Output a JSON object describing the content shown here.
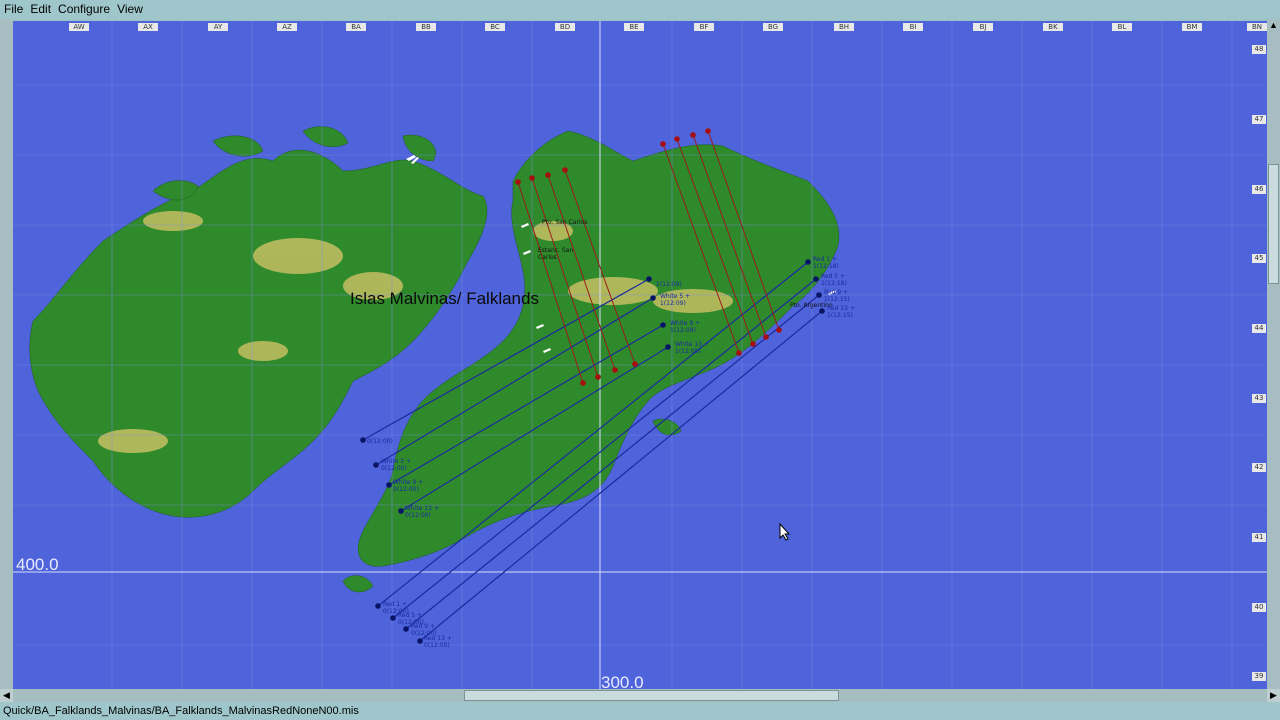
{
  "menu": {
    "file": "File",
    "edit": "Edit",
    "configure": "Configure",
    "view": "View"
  },
  "map": {
    "island_label": "Islas Malvinas/ Falklands",
    "scale_left": "400.0",
    "scale_bottom": "300.0",
    "columns": [
      "AW",
      "AX",
      "AY",
      "AZ",
      "BA",
      "BB",
      "BC",
      "BD",
      "BE",
      "BF",
      "BG",
      "BH",
      "BI",
      "BJ",
      "BK",
      "BL",
      "BM",
      "BN"
    ],
    "rows": [
      "48",
      "47",
      "46",
      "45",
      "44",
      "43",
      "42",
      "41",
      "40",
      "39"
    ],
    "places": {
      "san_carlos": "Pto. San Carlos",
      "estancia": "Estanc. San Carlos",
      "argentino": "Pto. Argentino"
    },
    "flights": {
      "white_start": [
        "0(12:00)",
        "White 5 + 0(12:00)",
        "White 9 + 0(12:00)",
        "White 13 + 0(12:00)"
      ],
      "red_start": [
        "Red 1 + 0(12:00)",
        "Red 5 + 0(12:00)",
        "Red 9 + 0(12:00)",
        "Red 13 + 0(12:00)"
      ],
      "white_end": [
        "1(12:09)",
        "White 5 + 1(12:09)",
        "White 9 + 1(12:09)",
        "White 13 + 1(12:09)"
      ],
      "red_end": [
        "Red 1 + 1(12:18)",
        "Red 5 + 1(12:18)",
        "Red 9 + 1(12:15)",
        "Red 13 + 1(12:15)"
      ]
    }
  },
  "colors": {
    "sea": "#4f63da",
    "land": "#2f8a2c",
    "highland": "#d9c56a",
    "blue_route": "#1b2a9e",
    "red_route": "#9a1a1a"
  },
  "status_bar": {
    "path": "Quick/BA_Falklands_Malvinas/BA_Falklands_MalvinasRedNoneN00.mis"
  }
}
